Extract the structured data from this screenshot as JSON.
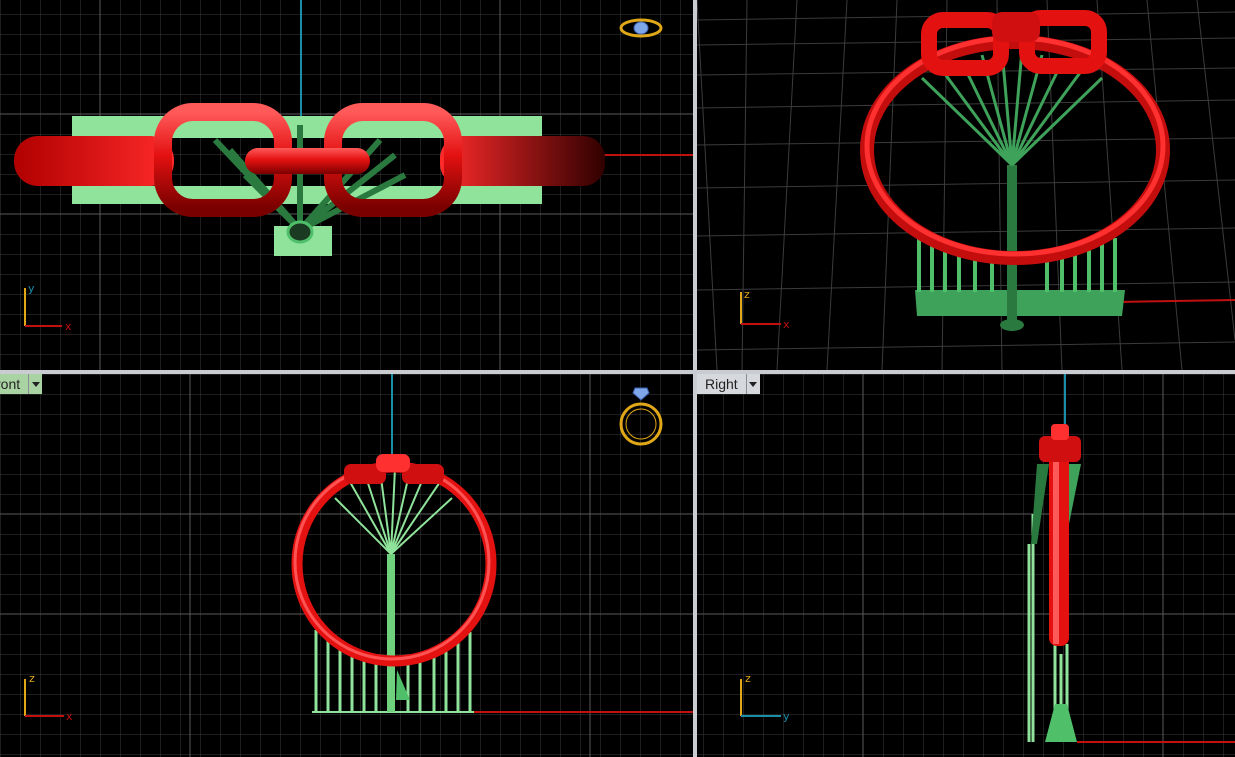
{
  "viewports": {
    "top": {
      "axes": {
        "vertical": "y",
        "horizontal": "x"
      }
    },
    "perspective": {
      "axes": {
        "vertical": "z",
        "horizontal": "x"
      }
    },
    "front": {
      "tab_label": "ront",
      "axes": {
        "vertical": "z",
        "horizontal": "x"
      }
    },
    "right": {
      "tab_label": "Right",
      "axes": {
        "vertical": "z",
        "horizontal": "y"
      }
    }
  },
  "colors": {
    "background": "#000000",
    "grid": "#3b3b3b",
    "grid_major": "#5a5a5a",
    "ring": "#e41111",
    "supports": "#4fbf6a",
    "supports_dark": "#2a7a3f",
    "axis_x": "#c01010",
    "axis_y_vertical": "#1a8fa8",
    "gizmo": "#e0a818",
    "active_tab": "#a9d3a2",
    "tab": "#d5d9dd"
  },
  "icons": [
    "ring-gizmo-icon",
    "dropdown-arrow-icon"
  ]
}
